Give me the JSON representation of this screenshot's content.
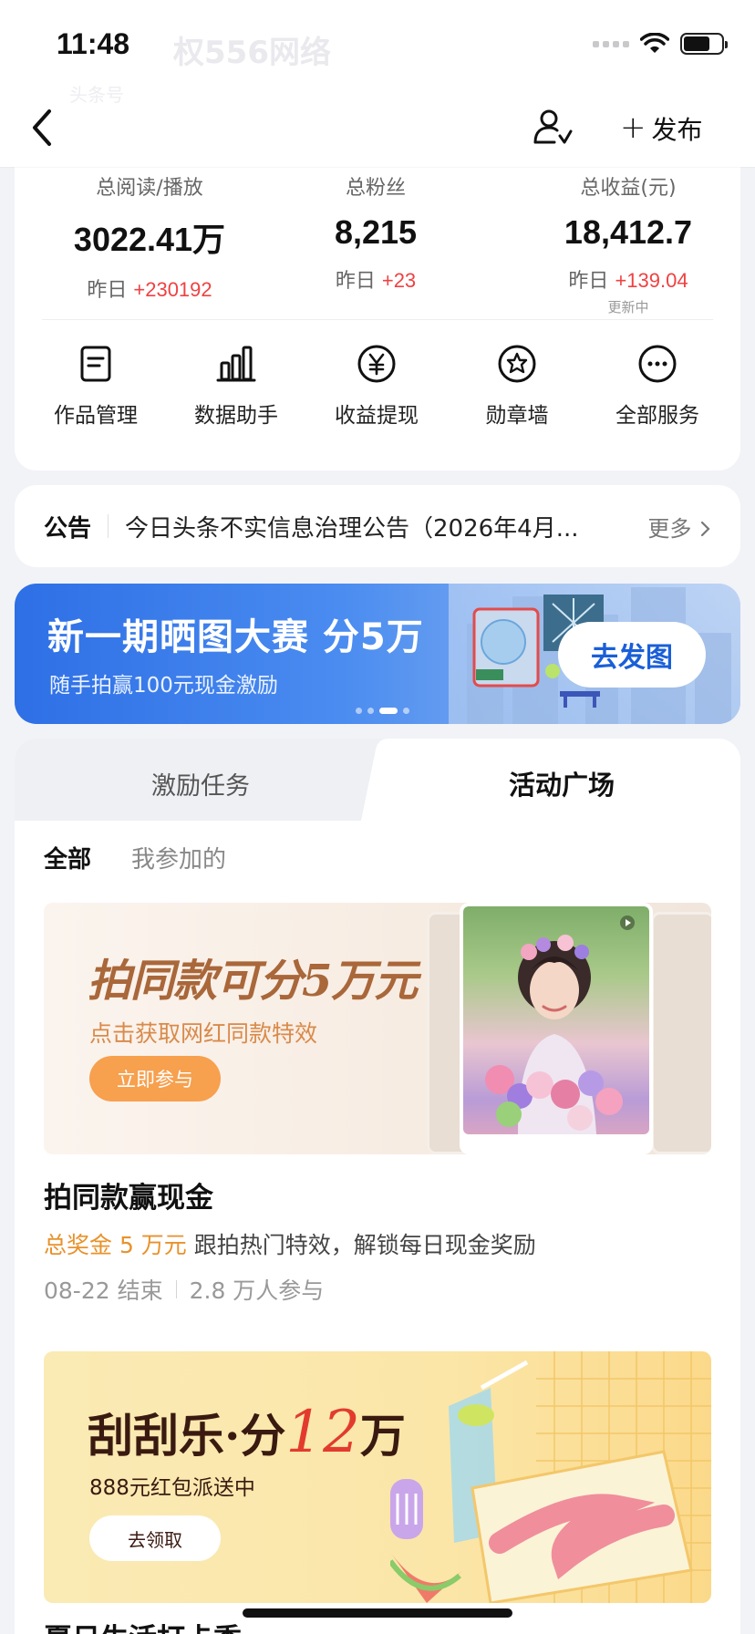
{
  "status_bar": {
    "time": "11:48"
  },
  "ghost_header": {
    "title": "权556网络",
    "sub1": "头条号",
    "sub2": ""
  },
  "nav": {
    "publish_label": "发布"
  },
  "stats": [
    {
      "label": "总阅读/播放",
      "value": "3022.41万",
      "delta_prefix": "昨日",
      "delta_value": "+230192",
      "note": ""
    },
    {
      "label": "总粉丝",
      "value": "8,215",
      "delta_prefix": "昨日",
      "delta_value": "+23",
      "note": ""
    },
    {
      "label": "总收益(元)",
      "value": "18,412.7",
      "delta_prefix": "昨日",
      "delta_value": "+139.04",
      "note": "更新中"
    }
  ],
  "services": [
    {
      "label": "作品管理",
      "icon": "document-icon"
    },
    {
      "label": "数据助手",
      "icon": "bar-chart-icon"
    },
    {
      "label": "收益提现",
      "icon": "yen-circle-icon"
    },
    {
      "label": "勋章墙",
      "icon": "medal-icon"
    },
    {
      "label": "全部服务",
      "icon": "more-dots-icon"
    }
  ],
  "announcement": {
    "title": "公告",
    "text": "今日头条不实信息治理公告（2026年4月...",
    "more": "更多"
  },
  "banner": {
    "title": "新一期晒图大赛 分5万",
    "subtitle": "随手拍赢100元现金激励",
    "button": "去发图",
    "pages": 4,
    "active_page": 3
  },
  "tabs": [
    {
      "label": "激励任务",
      "active": false
    },
    {
      "label": "活动广场",
      "active": true
    }
  ],
  "filters": [
    {
      "label": "全部",
      "active": true
    },
    {
      "label": "我参加的",
      "active": false
    }
  ],
  "activities": [
    {
      "image_title": "拍同款可分5万元",
      "image_subtitle": "点击获取网红同款特效",
      "image_button": "立即参与",
      "title": "拍同款赢现金",
      "prize": "总奖金 5 万元",
      "desc": "跟拍热门特效，解锁每日现金奖励",
      "end": "08-22 结束",
      "participants": "2.8 万人参与"
    },
    {
      "image_title_a": "刮刮乐·分",
      "image_title_num": "12",
      "image_title_b": "万",
      "image_subtitle": "888元红包派送中",
      "image_button": "去领取",
      "title": "夏日生活打卡季"
    }
  ],
  "colors": {
    "accent_red": "#f04142",
    "prize_orange": "#e8922c",
    "banner_blue": "#2e6fe6",
    "page_bg": "#f2f3f7"
  }
}
